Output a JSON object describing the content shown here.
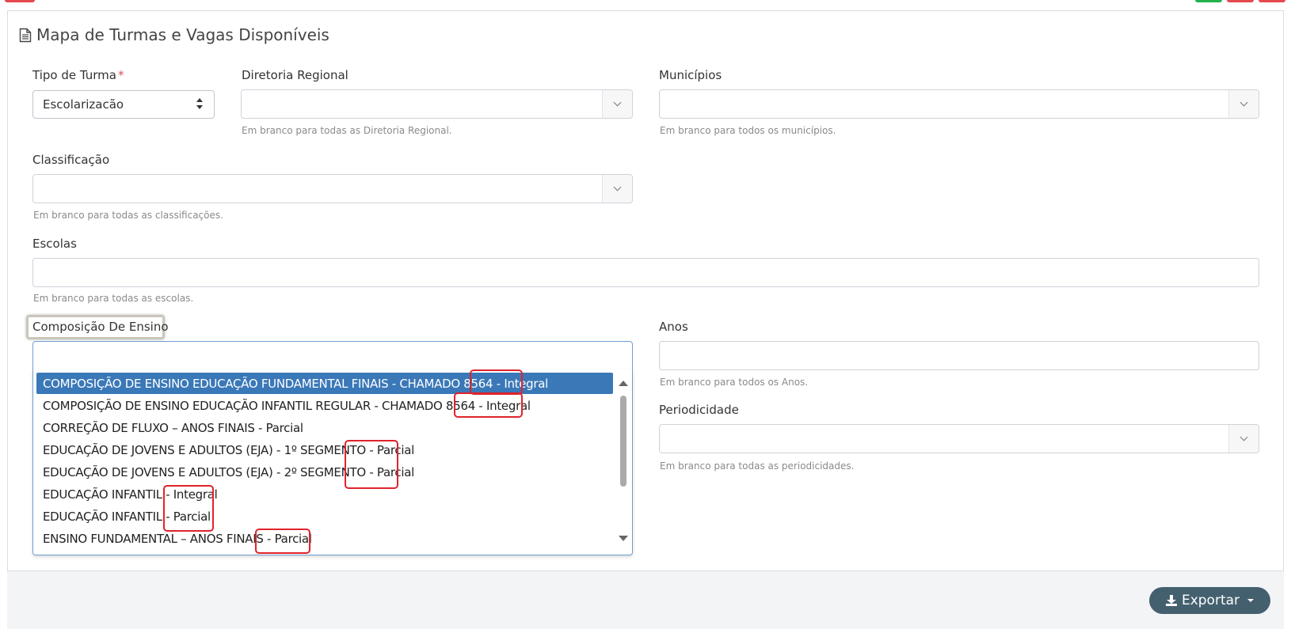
{
  "panel": {
    "title": "Mapa de Turmas e Vagas Disponíveis"
  },
  "fields": {
    "tipo_turma": {
      "label": "Tipo de Turma",
      "required_mark": "*",
      "value": "Escolarizacão"
    },
    "diretoria": {
      "label": "Diretoria Regional",
      "help": "Em branco para todas as Diretoria Regional."
    },
    "municipios": {
      "label": "Municípios",
      "help": "Em branco para todos os municípios."
    },
    "classificacao": {
      "label": "Classificação",
      "help": "Em branco para todas as classificações."
    },
    "escolas": {
      "label": "Escolas",
      "help": "Em branco para todas as escolas."
    },
    "composicao": {
      "label": "Composição De Ensino"
    },
    "anos": {
      "label": "Anos",
      "help": "Em branco para todos os Anos."
    },
    "periodicidade": {
      "label": "Periodicidade",
      "help": "Em branco para todas as periodicidades."
    }
  },
  "dropdown": {
    "options": [
      "COMPOSIÇÃO DE ENSINO EDUCAÇÃO FUNDAMENTAL FINAIS - CHAMADO 8564 - Integral",
      "COMPOSIÇÃO DE ENSINO EDUCAÇÃO INFANTIL REGULAR - CHAMADO 8564 - Integral",
      "CORREÇÃO DE FLUXO – ANOS FINAIS - Parcial",
      "EDUCAÇÃO DE JOVENS E ADULTOS (EJA) - 1º SEGMENTO - Parcial",
      "EDUCAÇÃO DE JOVENS E ADULTOS (EJA) - 2º SEGMENTO - Parcial",
      "EDUCAÇÃO INFANTIL - Integral",
      "EDUCAÇÃO INFANTIL - Parcial",
      "ENSINO FUNDAMENTAL – ANOS FINAIS - Parcial"
    ],
    "selected_index": 0
  },
  "actions": {
    "export_label": "Exportar"
  },
  "colors": {
    "selected_option": "#3a78b8",
    "annotation_red": "#e0232b",
    "export_button": "#44606f"
  },
  "icons": [
    "document-icon",
    "chevron-down-icon",
    "updown-arrows-icon",
    "download-icon",
    "caret-down-icon"
  ]
}
